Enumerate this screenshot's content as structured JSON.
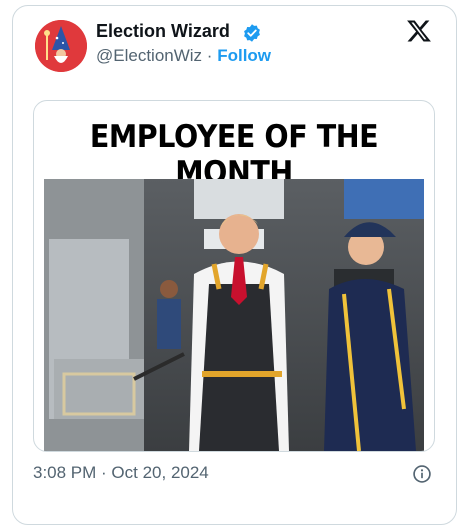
{
  "author": {
    "display_name": "Election Wizard",
    "handle": "@ElectionWiz",
    "separator": "·",
    "follow_label": "Follow",
    "verified": true
  },
  "media": {
    "headline": "EMPLOYEE OF THE MONTH"
  },
  "post": {
    "timestamp": "3:08 PM · Oct 20, 2024"
  },
  "icons": {
    "verified": "verified-badge-icon",
    "x_logo": "x-logo-icon",
    "info": "info-icon"
  },
  "colors": {
    "accent": "#1d9bf0",
    "text_primary": "#0f1419",
    "text_secondary": "#536471",
    "avatar_bg": "#e0393c"
  }
}
